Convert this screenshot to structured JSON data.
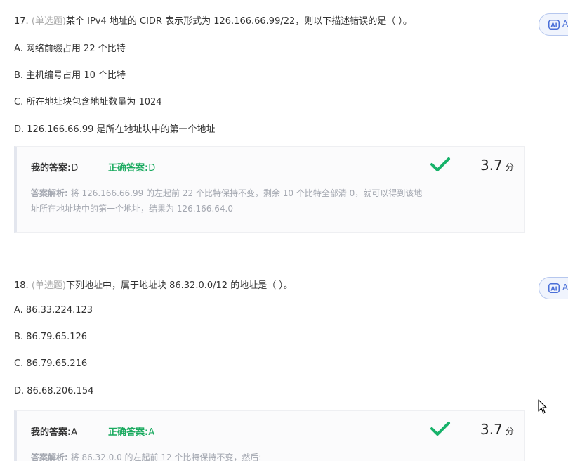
{
  "questions": [
    {
      "number": "17.",
      "type": "(单选题)",
      "text": "某个 IPv4 地址的 CIDR 表示形式为 126.166.66.99/22，则以下描述错误的是（ ）。",
      "options": [
        "A. 网络前缀占用 22 个比特",
        "B. 主机编号占用 10 个比特",
        "C. 所在地址块包含地址数量为 1024",
        "D. 126.166.66.99 是所在地址块中的第一个地址"
      ],
      "my_answer_label": "我的答案:",
      "my_answer": "D",
      "correct_answer_label": "正确答案:",
      "correct_answer": "D",
      "score": "3.7",
      "score_unit": "分",
      "analysis_label": "答案解析:",
      "analysis_line1": "将 126.166.66.99 的左起前 22 个比特保持不变，剩余 10 个比特全部清 0，就可以得到该地",
      "analysis_line2": "址所在地址块中的第一个地址，结果为 126.166.64.0",
      "ai_button": "AI"
    },
    {
      "number": "18.",
      "type": "(单选题)",
      "text": "下列地址中，属于地址块 86.32.0.0/12 的地址是（ ）。",
      "options": [
        "A. 86.33.224.123",
        "B. 86.79.65.126",
        "C. 86.79.65.216",
        "D. 86.68.206.154"
      ],
      "my_answer_label": "我的答案:",
      "my_answer": "A",
      "correct_answer_label": "正确答案:",
      "correct_answer": "A",
      "score": "3.7",
      "score_unit": "分",
      "analysis_label": "答案解析:",
      "analysis_line1": "将 86.32.0.0 的左起前 12 个比特保持不变，然后:",
      "ai_button": "AI"
    }
  ],
  "colors": {
    "correct_green": "#1aaa5f",
    "check_green": "#17b26a",
    "qtype_gray": "#aaaaaa",
    "analysis_gray": "#a3a7b0",
    "ai_blue": "#4a6fd8"
  },
  "icons": {
    "check": "check-icon",
    "ai": "ai-icon",
    "cursor": "mouse-cursor-icon"
  }
}
